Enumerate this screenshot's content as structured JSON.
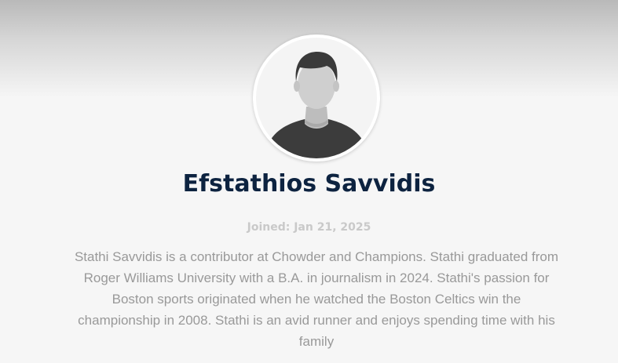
{
  "author": {
    "name": "Efstathios Savvidis",
    "joined": "Joined: Jan 21, 2025",
    "bio": "Stathi Savvidis is a contributor at Chowder and Champions. Stathi graduated from Roger Williams University with a B.A. in journalism in 2024. Stathi's passion for Boston sports originated when he watched the Boston Celtics win the championship in 2008. Stathi is an avid runner and enjoys spending time with his family",
    "avatar_icon": "default-user-avatar-icon"
  },
  "colors": {
    "name": "#0d2340",
    "joined": "#c9c9c9",
    "bio": "#999999",
    "background": "#f6f6f6"
  }
}
